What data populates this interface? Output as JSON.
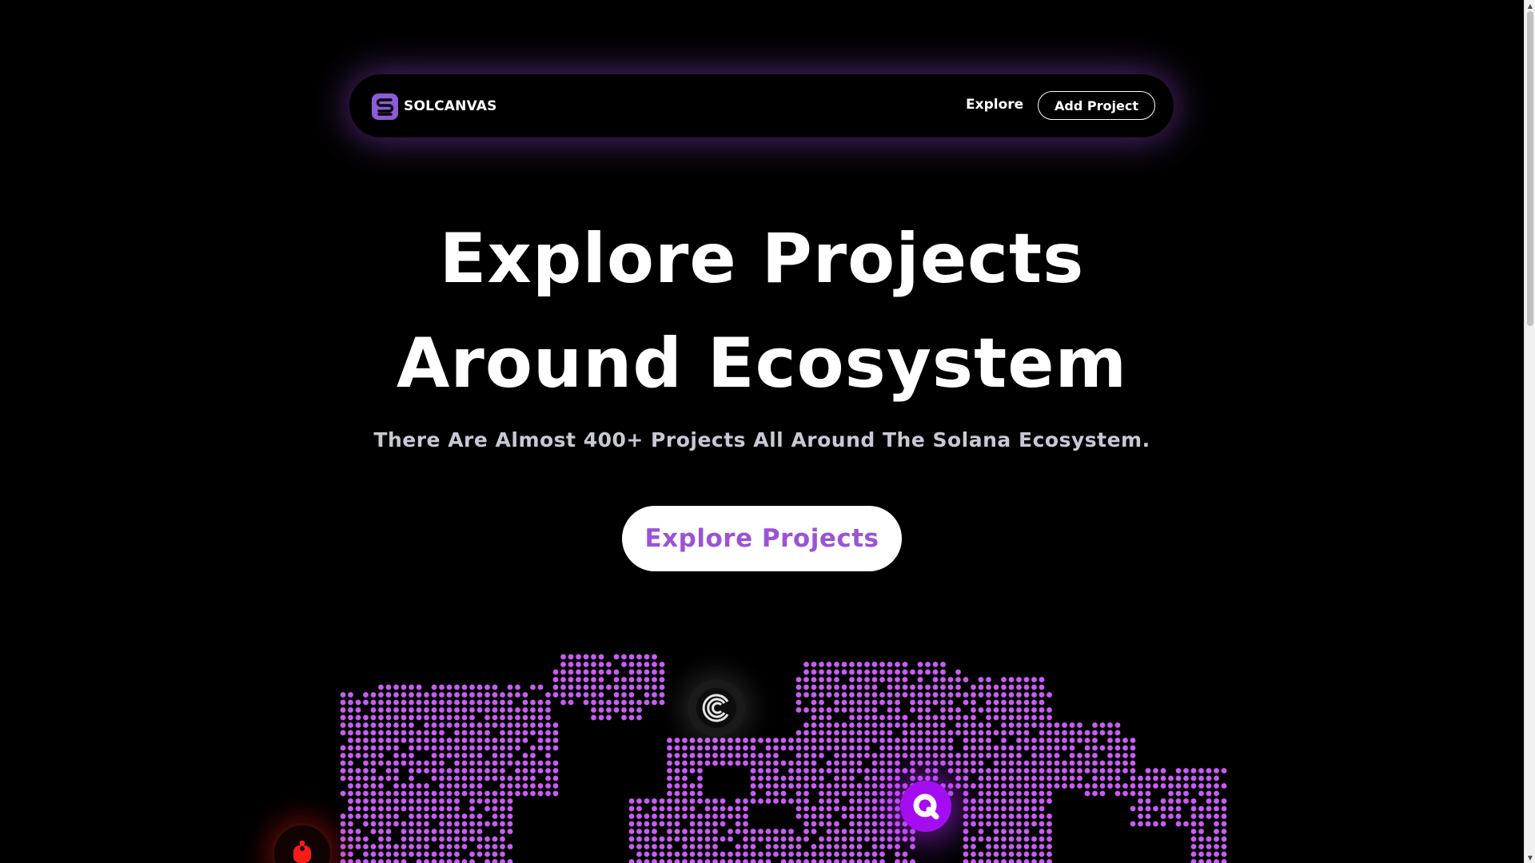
{
  "navbar": {
    "brand": "SOLCANVAS",
    "explore_label": "Explore",
    "add_project_label": "Add Project"
  },
  "hero": {
    "title_line_1": "Explore Projects",
    "title_line_2": "Around Ecosystem",
    "subtitle": "There Are Almost 400+ Projects All Around The Solana Ecosystem.",
    "cta_label": "Explore Projects"
  },
  "map": {
    "dot_color": "#c95cf6",
    "markers": [
      "swirl-logo-icon",
      "q-logo-icon",
      "robot-logo-icon"
    ]
  },
  "colors": {
    "background": "#000000",
    "accent": "#9b53d6",
    "glow": "#8f43ce"
  },
  "scrollbar": {
    "up_glyph": "▲",
    "down_glyph": "▼"
  }
}
